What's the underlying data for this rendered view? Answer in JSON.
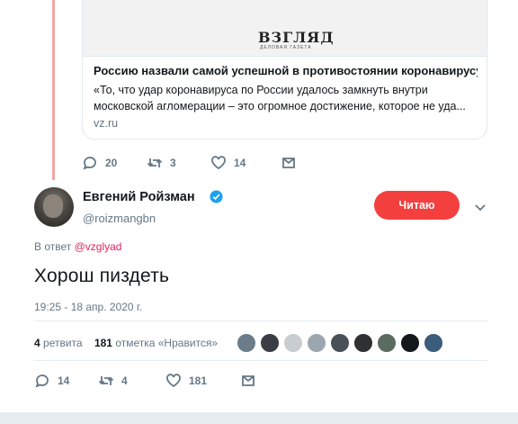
{
  "quoted_card": {
    "logo": "ВЗГЛЯД",
    "logo_sub": "ДЕЛОВАЯ ГАЗЕТА",
    "title": "Россию назвали самой успешной в противостоянии коронавирусу",
    "description": "«То, что удар коронавируса по России удалось замкнуть внутри московской агломерации – это огромное достижение, которое не уда...",
    "domain": "vz.ru"
  },
  "previous_actions": {
    "replies": "20",
    "retweets": "3",
    "likes": "14"
  },
  "tweet": {
    "author_name": "Евгений Ройзман",
    "author_handle": "@roizmangbn",
    "follow_label": "Читаю",
    "reply_prefix": "В ответ",
    "reply_handle": "@vzglyad",
    "text": "Хорош пиздеть",
    "timestamp": "19:25 - 18 апр. 2020 г.",
    "retweet_count": "4",
    "retweet_label": "ретвита",
    "like_count": "181",
    "like_label": "отметка «Нравится»"
  },
  "tweet_actions": {
    "replies": "14",
    "retweets": "4",
    "likes": "181"
  },
  "liker_colors": [
    "#6b7d8a",
    "#3a3e44",
    "#c9cdd1",
    "#9aa6b0",
    "#4a5058",
    "#2e3033",
    "#5c6b60",
    "#15181b",
    "#3b5c7a"
  ],
  "colors": {
    "accent_red": "#f43f3f",
    "link_red": "#e0245e",
    "thread_line": "#f4a6a6",
    "verified_blue": "#1da1f2"
  },
  "icons": [
    "reply-icon",
    "retweet-icon",
    "like-icon",
    "message-icon",
    "verified-icon",
    "chevron-down-icon"
  ]
}
